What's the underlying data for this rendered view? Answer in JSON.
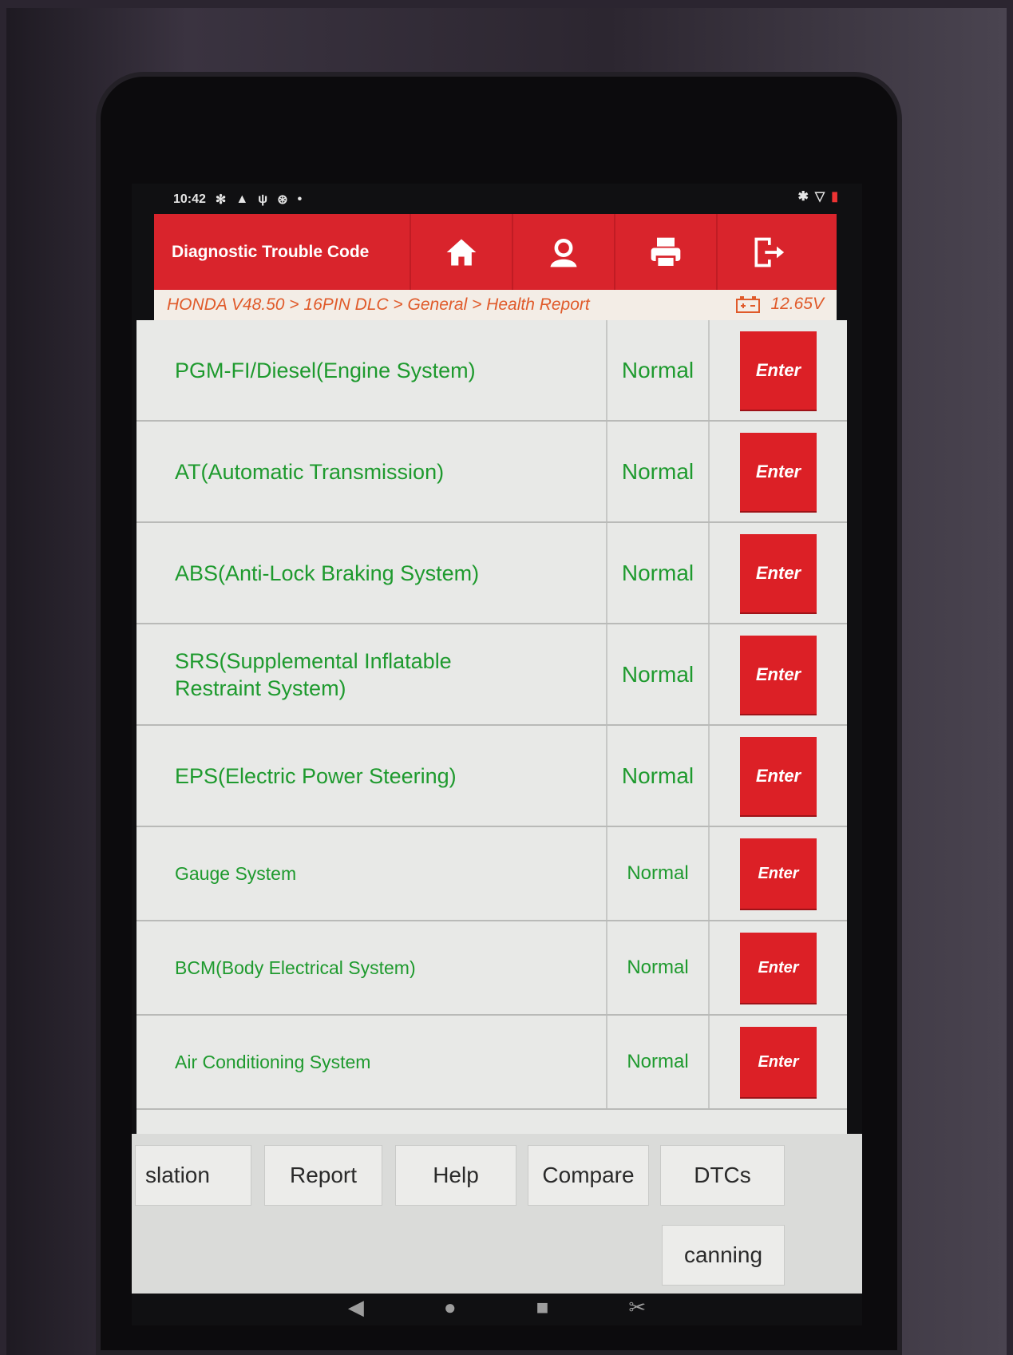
{
  "status_bar": {
    "time": "10:42",
    "left_icons": [
      "fan-icon",
      "warning-icon",
      "usb-icon",
      "settings-icon"
    ],
    "right_icons": [
      "bluetooth-icon",
      "wifi-icon",
      "battery-icon"
    ]
  },
  "header": {
    "title": "Diagnostic Trouble Code",
    "buttons": [
      "home-icon",
      "user-icon",
      "print-icon",
      "exit-icon"
    ]
  },
  "breadcrumb": {
    "path": "HONDA V48.50 > 16PIN DLC > General > Health Report",
    "voltage": "12.65V"
  },
  "systems": [
    {
      "name": "PGM-FI/Diesel(Engine System)",
      "status": "Normal",
      "action": "Enter"
    },
    {
      "name": "AT(Automatic Transmission)",
      "status": "Normal",
      "action": "Enter"
    },
    {
      "name": "ABS(Anti-Lock Braking System)",
      "status": "Normal",
      "action": "Enter"
    },
    {
      "name": "SRS(Supplemental Inflatable Restraint System)",
      "status": "Normal",
      "action": "Enter"
    },
    {
      "name": "EPS(Electric Power Steering)",
      "status": "Normal",
      "action": "Enter"
    },
    {
      "name": "Gauge System",
      "status": "Normal",
      "action": "Enter"
    },
    {
      "name": "BCM(Body Electrical System)",
      "status": "Normal",
      "action": "Enter"
    },
    {
      "name": "Air Conditioning System",
      "status": "Normal",
      "action": "Enter"
    }
  ],
  "toolbar": {
    "translation": "slation",
    "report": "Report",
    "help": "Help",
    "compare": "Compare",
    "dtcs": "DTCs",
    "scanning": "canning"
  },
  "colors": {
    "header_red": "#d9242c",
    "status_green": "#1e9a2e",
    "breadcrumb_orange": "#e05a2a"
  }
}
